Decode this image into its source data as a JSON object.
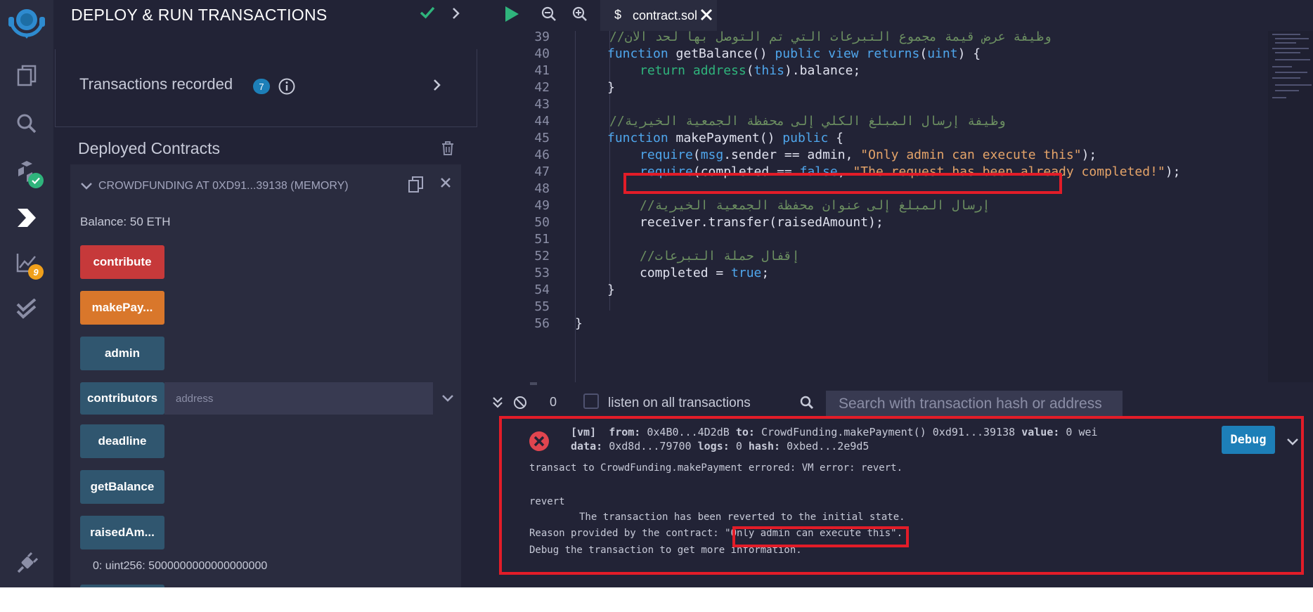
{
  "panel": {
    "title": "DEPLOY & RUN TRANSACTIONS",
    "transactions_label": "Transactions recorded",
    "transactions_count": "7",
    "deployed_title": "Deployed Contracts",
    "contract_header": "CROWDFUNDING AT 0XD91...39138 (MEMORY)",
    "balance": "Balance: 50 ETH",
    "buttons": [
      {
        "label": "contribute",
        "style": "red"
      },
      {
        "label": "makePay...",
        "style": "orange"
      },
      {
        "label": "admin",
        "style": "blue"
      },
      {
        "label": "contributors",
        "style": "blue"
      },
      {
        "label": "deadline",
        "style": "blue"
      },
      {
        "label": "getBalance",
        "style": "blue"
      },
      {
        "label": "raisedAm...",
        "style": "blue"
      }
    ],
    "address_placeholder": "address",
    "result": "0: uint256: 5000000000000000000"
  },
  "rail": {
    "icons": [
      "remix-logo-icon",
      "file-explorer-icon",
      "search-icon",
      "compiler-icon",
      "deploy-icon",
      "analytics-icon",
      "test-icon",
      "plugin-icon"
    ],
    "compiler_badge": "check",
    "analytics_badge": "9"
  },
  "editor": {
    "tab_label": "contract.sol",
    "lines": [
      {
        "n": "39",
        "text": "//وظيفة عرض قيمة مجموع التبرعات التي تم التوصل بها لحد الآن"
      },
      {
        "n": "40",
        "text": "function getBalance() public view returns(uint) {"
      },
      {
        "n": "41",
        "text": "return address(this).balance;"
      },
      {
        "n": "42",
        "text": "}"
      },
      {
        "n": "43",
        "text": ""
      },
      {
        "n": "44",
        "text": "//وظيفة إرسال المبلغ الكلي إلى محفظة الجمعية الخيرية"
      },
      {
        "n": "45",
        "text": "function makePayment() public {"
      },
      {
        "n": "46",
        "text": "require(msg.sender == admin, \"Only admin can execute this\");"
      },
      {
        "n": "47",
        "text": "require(completed == false, \"The request has been already completed!\");"
      },
      {
        "n": "48",
        "text": ""
      },
      {
        "n": "49",
        "text": "//إرسال المبلغ إلى عنوان محفظة الجمعية الخيرية"
      },
      {
        "n": "50",
        "text": "receiver.transfer(raisedAmount);"
      },
      {
        "n": "51",
        "text": ""
      },
      {
        "n": "52",
        "text": "//إقفال حملة التبرعات"
      },
      {
        "n": "53",
        "text": "completed = true;"
      },
      {
        "n": "54",
        "text": "}"
      },
      {
        "n": "55",
        "text": ""
      },
      {
        "n": "56",
        "text": "}"
      }
    ]
  },
  "terminal": {
    "pending_count": "0",
    "listen_label": "listen on all transactions",
    "search_placeholder": "Search with transaction hash or address",
    "debug_label": "Debug",
    "vm": "[vm]",
    "from_key": "from:",
    "from_val": "0x4B0...4D2dB",
    "to_key": "to:",
    "to_val": "CrowdFunding.makePayment() 0xd91...39138",
    "value_key": "value:",
    "value_val": "0 wei",
    "data_key": "data:",
    "data_val": "0xd8d...79700",
    "logs_key": "logs:",
    "logs_val": "0",
    "hash_key": "hash:",
    "hash_val": "0xbed...2e9d5",
    "msg1": "transact to CrowdFunding.makePayment errored: VM error: revert.",
    "msg2": "revert",
    "msg3": "The transaction has been reverted to the initial state.",
    "msg4_prefix": "Reason provided by the contract:",
    "msg4_reason": "\"Only admin can execute this\".",
    "msg5": "Debug the transaction to get more information."
  },
  "colors": {
    "background": "#222336",
    "panel": "#2a2c3f",
    "accent": "#1d7fb8",
    "highlight": "#e21c28",
    "error": "#e0454f"
  }
}
